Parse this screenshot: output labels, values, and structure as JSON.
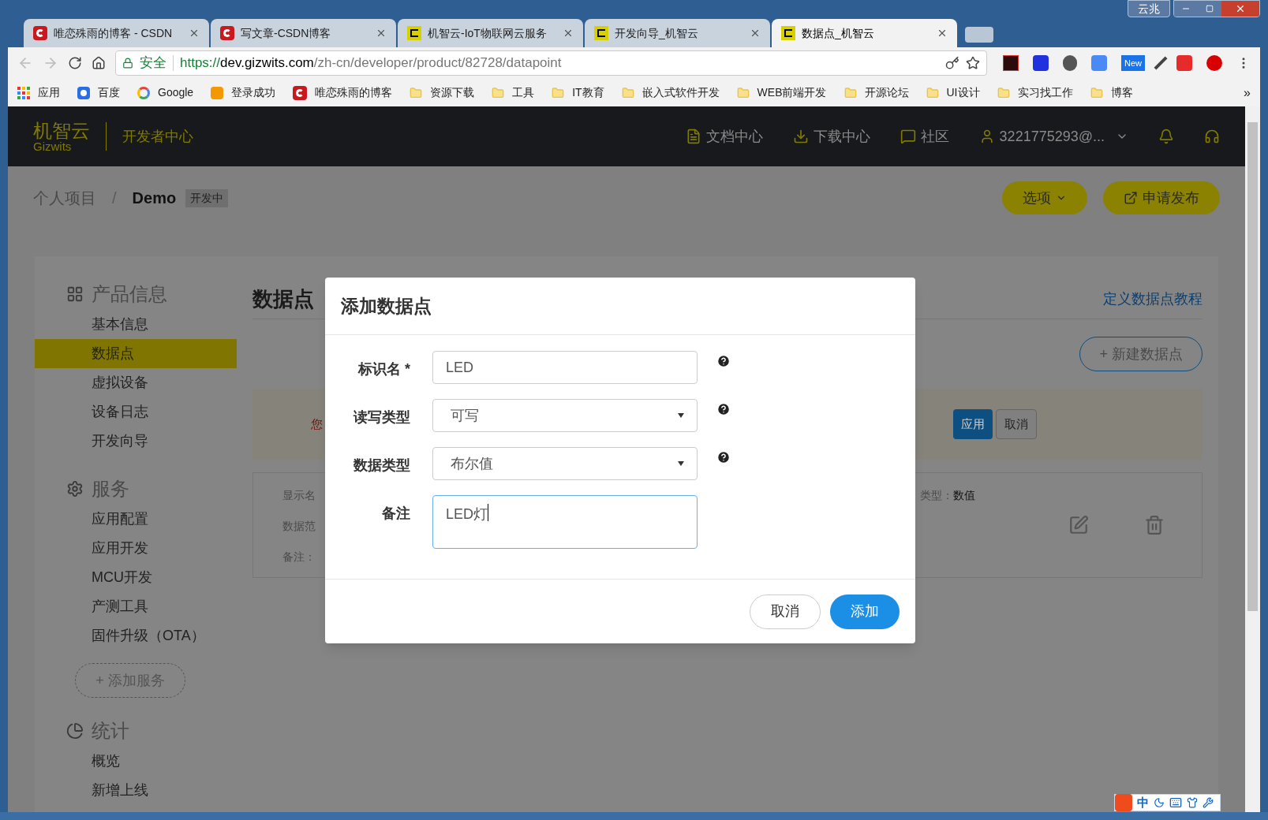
{
  "browser": {
    "tabs": [
      {
        "kind": "csdn",
        "title": "唯恋殊雨的博客 - CSDN",
        "selected": false
      },
      {
        "kind": "csdn",
        "title": "写文章-CSDN博客",
        "selected": false
      },
      {
        "kind": "gizwits",
        "title": "机智云-IoT物联网云服务",
        "selected": false
      },
      {
        "kind": "gizwits",
        "title": "开发向导_机智云",
        "selected": false
      },
      {
        "kind": "gizwits",
        "title": "数据点_机智云",
        "selected": true
      }
    ],
    "profile": "云兆",
    "security": "安全",
    "url_scheme": "https://",
    "url_host": "dev.gizwits.com",
    "url_path": "/zh-cn/developer/product/82728/datapoint",
    "extension_badge": "New",
    "bookmarks": [
      {
        "kind": "apps",
        "label": "应用"
      },
      {
        "kind": "baidu",
        "label": "百度"
      },
      {
        "kind": "google",
        "label": "Google"
      },
      {
        "kind": "ep",
        "label": "登录成功"
      },
      {
        "kind": "csdn",
        "label": "唯恋殊雨的博客"
      },
      {
        "kind": "folder",
        "label": "资源下载"
      },
      {
        "kind": "folder",
        "label": "工具"
      },
      {
        "kind": "folder",
        "label": "IT教育"
      },
      {
        "kind": "folder",
        "label": "嵌入式软件开发"
      },
      {
        "kind": "folder",
        "label": "WEB前端开发"
      },
      {
        "kind": "folder",
        "label": "开源论坛"
      },
      {
        "kind": "folder",
        "label": "UI设计"
      },
      {
        "kind": "folder",
        "label": "实习找工作"
      },
      {
        "kind": "folder",
        "label": "博客"
      }
    ],
    "more": "»"
  },
  "header": {
    "logo_cn": "机智云",
    "logo_en": "Gizwits",
    "site": "开发者中心",
    "nav": [
      {
        "kind": "doc",
        "label": "文档中心"
      },
      {
        "kind": "download",
        "label": "下载中心"
      },
      {
        "kind": "chat",
        "label": "社区"
      },
      {
        "kind": "user",
        "label": "3221775293@..."
      }
    ]
  },
  "breadcrumb": {
    "parent": "个人项目",
    "separator": "/",
    "current": "Demo",
    "badge": "开发中"
  },
  "actions": [
    {
      "kind": "dropdown",
      "label": "选项"
    },
    {
      "kind": "external",
      "label": "申请发布"
    }
  ],
  "sidebar": [
    {
      "kind": "grid",
      "title": "产品信息",
      "items": [
        {
          "label": "基本信息",
          "selected": false
        },
        {
          "label": "数据点",
          "selected": true
        },
        {
          "label": "虚拟设备",
          "selected": false
        },
        {
          "label": "设备日志",
          "selected": false
        },
        {
          "label": "开发向导",
          "selected": false
        }
      ]
    },
    {
      "kind": "service",
      "title": "服务",
      "items": [
        {
          "label": "应用配置",
          "selected": false
        },
        {
          "label": "应用开发",
          "selected": false
        },
        {
          "label": "MCU开发",
          "selected": false
        },
        {
          "label": "产测工具",
          "selected": false
        },
        {
          "label": "固件升级（OTA）",
          "selected": false
        }
      ],
      "add_button": "+ 添加服务"
    },
    {
      "kind": "pie",
      "title": "统计",
      "items": [
        {
          "label": "概览",
          "selected": false
        },
        {
          "label": "新增上线",
          "selected": false
        }
      ]
    }
  ],
  "main": {
    "title": "数据点",
    "tutorial_link": "定义数据点教程",
    "new_button": "+ 新建数据点",
    "notice": {
      "text": "您",
      "apply": "应用",
      "cancel": "取消"
    },
    "datapoint": {
      "lines": [
        "显示名",
        "数据范",
        "备注："
      ],
      "type_label": "类型：",
      "type_value": "数值"
    }
  },
  "dialog": {
    "title": "添加数据点",
    "fields": [
      {
        "kind": "text",
        "label": "标识名 *",
        "value": "LED",
        "help": true,
        "focused": false
      },
      {
        "kind": "select",
        "label": "读写类型",
        "value": "可写",
        "help": true,
        "focused": false
      },
      {
        "kind": "select",
        "label": "数据类型",
        "value": "布尔值",
        "help": true,
        "focused": false
      },
      {
        "kind": "textarea",
        "label": "备注",
        "value": "LED灯",
        "help": false,
        "focused": true
      }
    ],
    "cancel": "取消",
    "submit": "添加"
  },
  "ime": {
    "mode": "中"
  }
}
